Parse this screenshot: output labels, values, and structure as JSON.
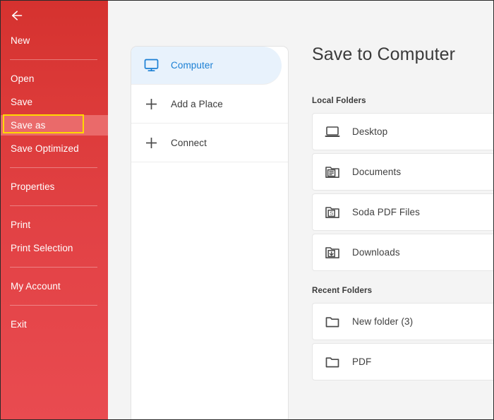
{
  "window": {
    "background_color": "#f4f4f4",
    "accent_red": "#e24245",
    "highlight_color": "#ffd800",
    "link_blue": "#1a7fd4"
  },
  "sidebar": {
    "back_icon": "arrow-left-icon",
    "items": [
      {
        "label": "New",
        "selected": false
      },
      {
        "label": "Open",
        "selected": false
      },
      {
        "label": "Save",
        "selected": false
      },
      {
        "label": "Save as",
        "selected": true
      },
      {
        "label": "Save Optimized",
        "selected": false
      },
      {
        "label": "Properties",
        "selected": false
      },
      {
        "label": "Print",
        "selected": false
      },
      {
        "label": "Print Selection",
        "selected": false
      },
      {
        "label": "My Account",
        "selected": false
      },
      {
        "label": "Exit",
        "selected": false
      }
    ]
  },
  "places": {
    "items": [
      {
        "label": "Computer",
        "icon": "monitor-icon",
        "active": true
      },
      {
        "label": "Add a Place",
        "icon": "plus-icon",
        "active": false
      },
      {
        "label": "Connect",
        "icon": "plus-icon",
        "active": false
      }
    ]
  },
  "main": {
    "title": "Save to Computer",
    "local_folders": {
      "heading": "Local Folders",
      "items": [
        {
          "label": "Desktop",
          "icon": "laptop-icon"
        },
        {
          "label": "Documents",
          "icon": "folder-document-icon"
        },
        {
          "label": "Soda PDF Files",
          "icon": "folder-soda-icon"
        },
        {
          "label": "Downloads",
          "icon": "folder-download-icon"
        }
      ]
    },
    "recent_folders": {
      "heading": "Recent Folders",
      "items": [
        {
          "label": "New folder (3)",
          "icon": "folder-icon"
        },
        {
          "label": "PDF",
          "icon": "folder-icon"
        }
      ]
    }
  }
}
